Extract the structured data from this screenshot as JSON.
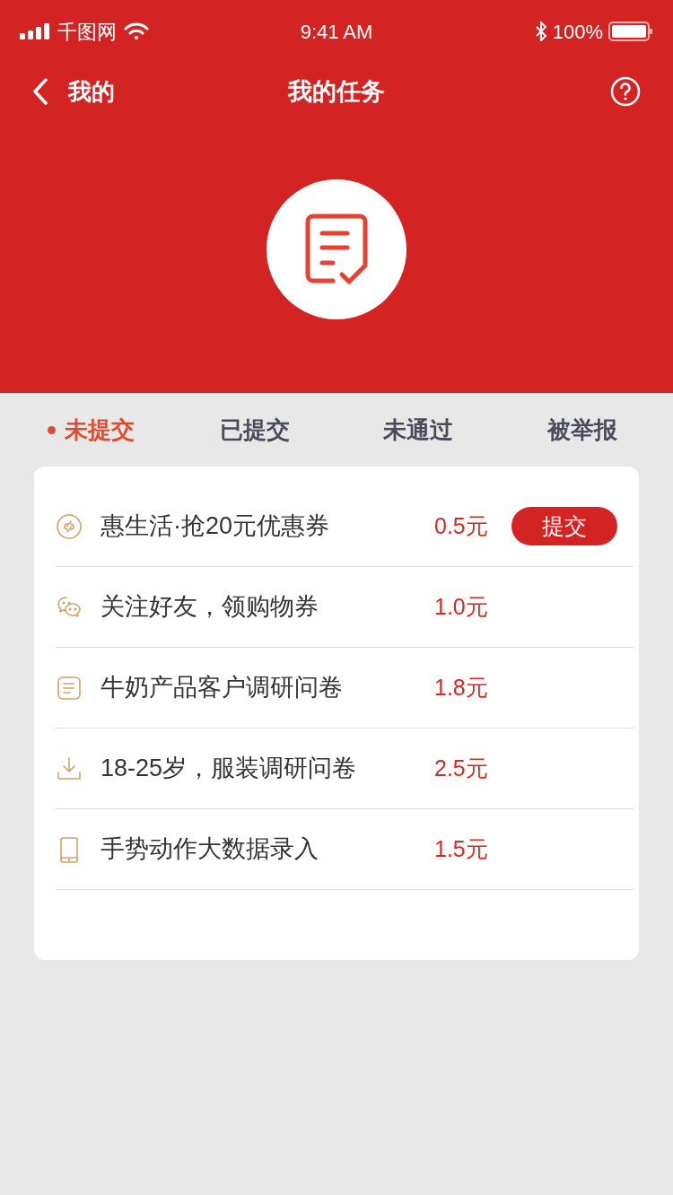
{
  "status_bar": {
    "carrier": "千图网",
    "time": "9:41 AM",
    "battery": "100%"
  },
  "nav": {
    "back_label": "我的",
    "title": "我的任务"
  },
  "tabs": [
    {
      "label": "未提交",
      "selected": true
    },
    {
      "label": "已提交",
      "selected": false
    },
    {
      "label": "未通过",
      "selected": false
    },
    {
      "label": "被举报",
      "selected": false
    }
  ],
  "tasks": [
    {
      "kind": "link",
      "title": "惠生活·抢20元优惠券",
      "reward": "0.5元",
      "action": "提交"
    },
    {
      "kind": "chat",
      "title": "关注好友，领购物券",
      "reward": "1.0元"
    },
    {
      "kind": "list",
      "title": "牛奶产品客户调研问卷",
      "reward": "1.8元"
    },
    {
      "kind": "download",
      "title": "18-25岁，服装调研问卷",
      "reward": "2.5元"
    },
    {
      "kind": "phone",
      "title": "手势动作大数据录入",
      "reward": "1.5元"
    }
  ]
}
